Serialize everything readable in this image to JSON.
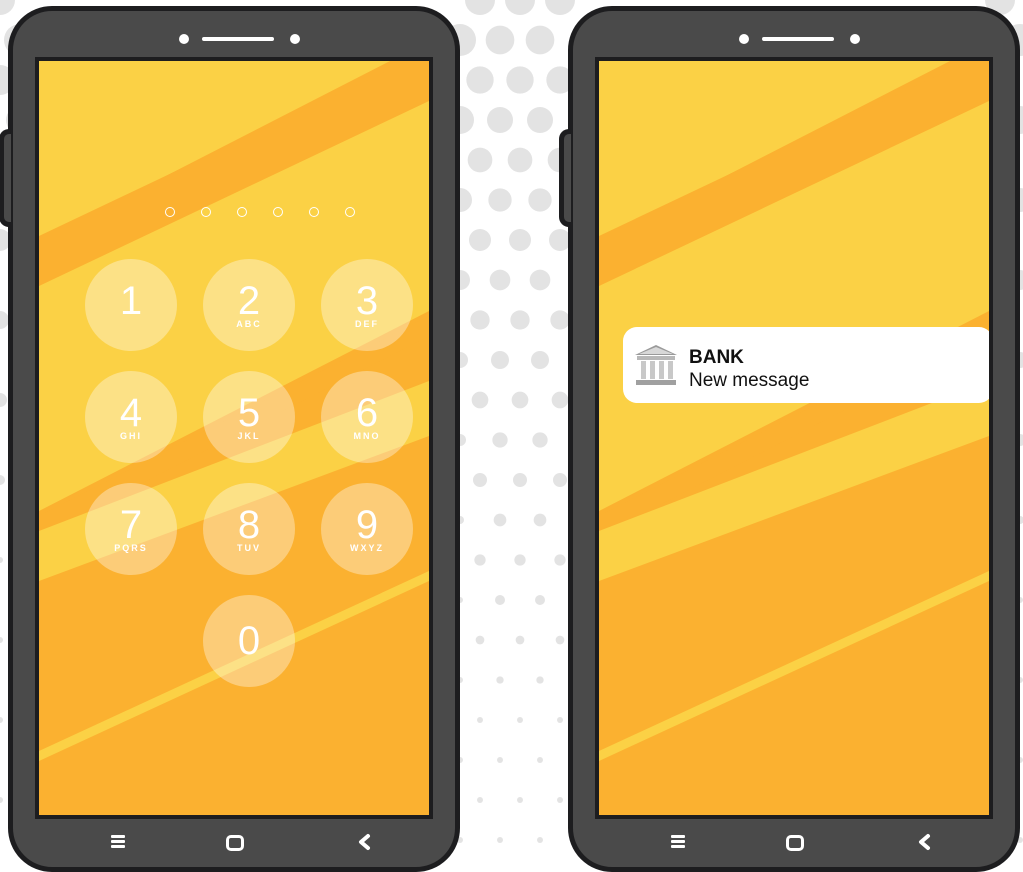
{
  "lock_screen": {
    "pin_length": 6,
    "keys": [
      {
        "digit": "1",
        "letters": ""
      },
      {
        "digit": "2",
        "letters": "ABC"
      },
      {
        "digit": "3",
        "letters": "DEF"
      },
      {
        "digit": "4",
        "letters": "GHI"
      },
      {
        "digit": "5",
        "letters": "JKL"
      },
      {
        "digit": "6",
        "letters": "MNO"
      },
      {
        "digit": "7",
        "letters": "PQRS"
      },
      {
        "digit": "8",
        "letters": "TUV"
      },
      {
        "digit": "9",
        "letters": "WXYZ"
      },
      {
        "digit": "0",
        "letters": ""
      }
    ]
  },
  "notification": {
    "title": "BANK",
    "message": "New message",
    "icon": "bank-icon"
  },
  "nav": {
    "menu_icon": "menu-icon",
    "home_icon": "home-icon",
    "back_icon": "back-icon"
  },
  "colors": {
    "screen_orange": "#fbb130",
    "screen_yellow": "#fbd145",
    "phone_body": "#4a4a4a",
    "phone_outline": "#1d1d1f",
    "pattern_gray": "#e3e3e3"
  }
}
